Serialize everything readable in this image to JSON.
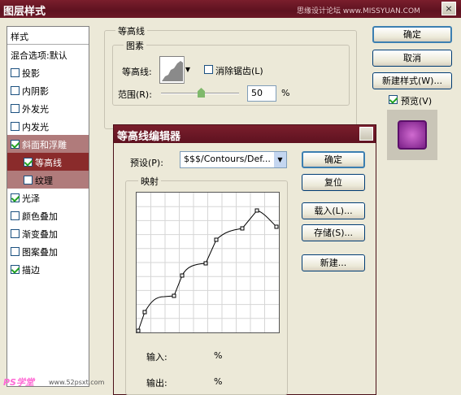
{
  "window": {
    "title": "图层样式",
    "close": "×",
    "watermark": "思缘设计论坛 www.MISSYUAN.COM"
  },
  "sidebar": {
    "header": "样式",
    "items": [
      {
        "label": "混合选项:默认",
        "checked": null,
        "selected": false
      },
      {
        "label": "投影",
        "checked": false
      },
      {
        "label": "内阴影",
        "checked": false
      },
      {
        "label": "外发光",
        "checked": false
      },
      {
        "label": "内发光",
        "checked": false
      },
      {
        "label": "斜面和浮雕",
        "checked": true,
        "selected": true
      },
      {
        "label": "等高线",
        "checked": true,
        "selected": true,
        "sub": true
      },
      {
        "label": "纹理",
        "checked": false,
        "sub": true
      },
      {
        "label": "光泽",
        "checked": true
      },
      {
        "label": "颜色叠加",
        "checked": false
      },
      {
        "label": "渐变叠加",
        "checked": false
      },
      {
        "label": "图案叠加",
        "checked": false
      },
      {
        "label": "描边",
        "checked": true
      }
    ]
  },
  "main": {
    "group_title": "等高线",
    "sub_title": "图素",
    "contour_label": "等高线:",
    "antialias_label": "消除锯齿(L)",
    "range_label": "范围(R):",
    "range_value": "50",
    "range_unit": "%",
    "range_level_percent": 50
  },
  "buttons": {
    "ok": "确定",
    "cancel": "取消",
    "new_style": "新建样式(W)...",
    "preview_label": "预览(V)"
  },
  "editor": {
    "title": "等高线编辑器",
    "preset_label": "预设(P):",
    "preset_value": "$$$/Contours/Def...",
    "mapping_label": "映射",
    "input_label": "输入:",
    "input_unit": "%",
    "output_label": "输出:",
    "output_unit": "%",
    "ok": "确定",
    "reset": "复位",
    "load": "载入(L)...",
    "save": "存储(S)...",
    "new": "新建..."
  },
  "bottom_watermark": {
    "brand": "PS学堂",
    "site": "www.52psxt.com"
  },
  "colors": {
    "titlebar": "#6b1826",
    "selected": "#b07b7b",
    "selected_dark": "#8a2b2b",
    "check": "#21a121"
  }
}
